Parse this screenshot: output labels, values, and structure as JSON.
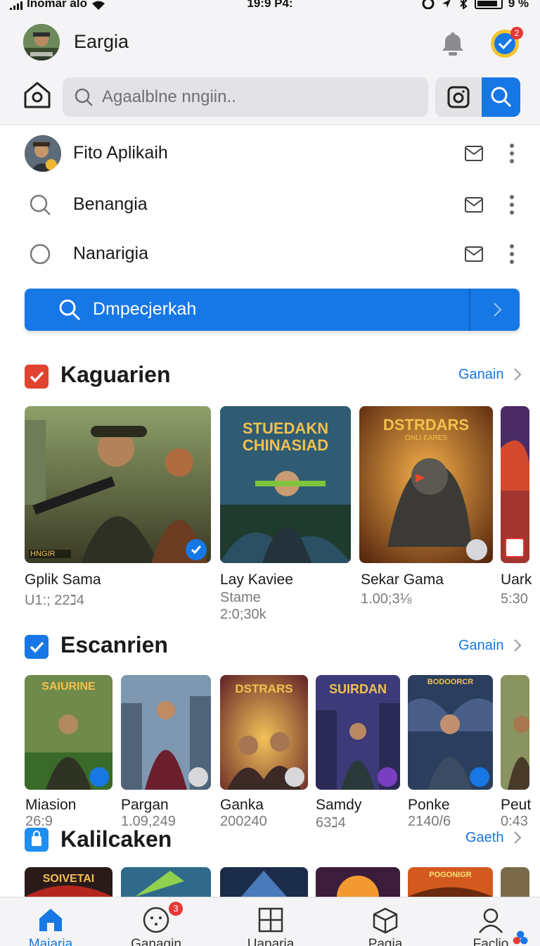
{
  "status_bar": {
    "carrier": "Inomar alo",
    "time": "19:9 P4:",
    "battery": "9 %"
  },
  "header": {
    "title": "Eargia",
    "notification_count": "2",
    "search": {
      "placeholder": "Agaalblne nngiin.."
    }
  },
  "list": [
    {
      "label": "Fito Aplikaih",
      "lead": "avatar"
    },
    {
      "label": "Benangia",
      "lead": "search-icon"
    },
    {
      "label": "Nanarigia",
      "lead": "circle-icon"
    }
  ],
  "primary_action": {
    "label": "Dmpecjerkah"
  },
  "sections": [
    {
      "title": "Kaguarien",
      "link": "Ganain",
      "icon": "check-icon",
      "icon_color": "#e0432f",
      "games": [
        {
          "name": "Gplik Sama",
          "sub": "U1:; 22ℷ4",
          "cover_text": "HNGIR",
          "badge": "verified"
        },
        {
          "name": "Lay Kaviee",
          "sub": "Stame",
          "sub2": "2:0;30k",
          "cover_text": "STUEDAKN CHINASIAD"
        },
        {
          "name": "Sekar Gama",
          "sub": "1.00;3⅛",
          "cover_text": "DSTRDARS",
          "cover_sub": "ONLI EARES",
          "badge": "more"
        },
        {
          "name": "Uark",
          "sub": "5:30",
          "badge": "game"
        }
      ]
    },
    {
      "title": "Escanrien",
      "link": "Ganain",
      "icon": "check-icon",
      "icon_color": "#1677e5",
      "games": [
        {
          "name": "Miasion",
          "sub": "26:9",
          "cover_text": "SAIURINE",
          "badge": "verified"
        },
        {
          "name": "Pargan",
          "sub": "1.09,249",
          "badge": "more"
        },
        {
          "name": "Ganka",
          "sub": "200240",
          "cover_text": "DSTRARS",
          "badge": "more"
        },
        {
          "name": "Samdy",
          "sub": "63ℷ4",
          "cover_text": "SUIRDAN",
          "badge": "game"
        },
        {
          "name": "Ponke",
          "sub": "2140/6",
          "cover_text": "BODOORCR",
          "badge": "verified"
        },
        {
          "name": "Peut",
          "sub": "0:43"
        }
      ]
    },
    {
      "title": "Kalilcaken",
      "link": "Gaeth",
      "icon": "bag-icon",
      "icon_color": "#1677e5",
      "games": [
        {
          "cover_text": "SOIVETAI"
        },
        {
          "cover_text": ""
        },
        {
          "cover_text": ""
        },
        {
          "cover_text": ""
        },
        {
          "cover_text": "POGONIGR"
        },
        {
          "cover_text": ""
        }
      ]
    }
  ],
  "bottom_nav": [
    {
      "label": "Maiaria",
      "icon": "home-icon",
      "active": true
    },
    {
      "label": "Ganagin",
      "icon": "gamepad-icon",
      "badge": "3"
    },
    {
      "label": "Uaparia",
      "icon": "grid-icon"
    },
    {
      "label": "Pagia",
      "icon": "box-icon"
    },
    {
      "label": "Faclio",
      "icon": "user-icon"
    }
  ],
  "colors": {
    "accent": "#1677e5",
    "bg": "#ffffff",
    "header_bg": "#f4f4f6"
  }
}
